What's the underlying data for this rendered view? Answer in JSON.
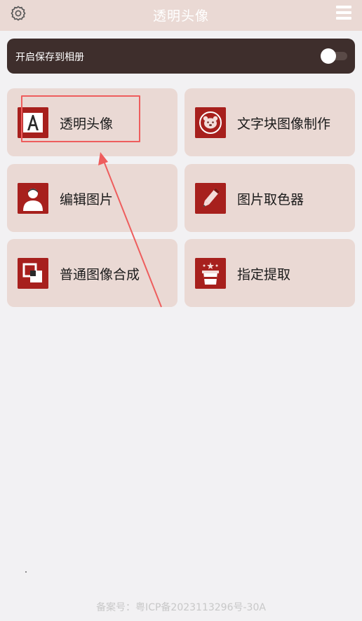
{
  "header": {
    "title": "透明头像",
    "settings_icon": "gear-icon",
    "menu_icon": "hamburger-menu-icon"
  },
  "savebar": {
    "label": "开启保存到相册",
    "toggle_on": false
  },
  "features": [
    {
      "label": "透明头像",
      "icon": "letter-a-icon"
    },
    {
      "label": "文字块图像制作",
      "icon": "bear-face-icon"
    },
    {
      "label": "编辑图片",
      "icon": "person-avatar-icon"
    },
    {
      "label": "图片取色器",
      "icon": "pen-color-picker-icon"
    },
    {
      "label": "普通图像合成",
      "icon": "overlap-squares-icon"
    },
    {
      "label": "指定提取",
      "icon": "magic-hat-icon"
    }
  ],
  "footer": {
    "icp": "备案号：粤ICP备2023113296号-30A"
  },
  "colors": {
    "accent": "#a7201d",
    "card": "#ead9d4",
    "header": "#ead9d4",
    "savebar": "#3e2e2c",
    "annotation": "#ee5d5d"
  }
}
